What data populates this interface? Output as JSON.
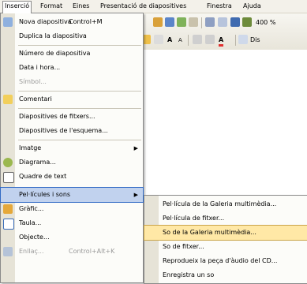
{
  "menubar": {
    "items": [
      {
        "label": "Inserció",
        "active": true
      },
      {
        "label": "Format"
      },
      {
        "label": "Eines"
      },
      {
        "label": "Presentació de diapositives"
      },
      {
        "label": "Finestra"
      },
      {
        "label": "Ajuda"
      }
    ]
  },
  "toolbar": {
    "zoom": "400 %",
    "font_grow_label": "A",
    "font_shrink_label": "A",
    "design_label": "Dis"
  },
  "insert_menu": {
    "items": [
      {
        "label": "Nova diapositiva",
        "shortcut": "Control+M",
        "icon": "new-slide-icon"
      },
      {
        "label": "Duplica la diapositiva"
      },
      {
        "label": "Número de diapositiva"
      },
      {
        "label": "Data i hora..."
      },
      {
        "label": "Símbol...",
        "disabled": true
      },
      {
        "label": "Comentari",
        "icon": "comment-icon"
      },
      {
        "label": "Diapositives de fitxers..."
      },
      {
        "label": "Diapositives de l'esquema..."
      },
      {
        "label": "Imatge",
        "submenu": true
      },
      {
        "label": "Diagrama...",
        "icon": "diagram-icon"
      },
      {
        "label": "Quadre de text",
        "icon": "text-box-icon"
      },
      {
        "label": "Pel·lícules i sons",
        "submenu": true,
        "highlighted": true,
        "icon": "movie-sound-icon"
      },
      {
        "label": "Gràfic...",
        "icon": "chart-icon"
      },
      {
        "label": "Taula...",
        "icon": "table-icon"
      },
      {
        "label": "Objecte..."
      },
      {
        "label": "Enllaç...",
        "shortcut": "Control+Alt+K",
        "disabled": true,
        "icon": "hyperlink-icon"
      }
    ]
  },
  "movies_submenu": {
    "items": [
      {
        "label": "Pel·lícula de la Galeria multimèdia...",
        "icon": "clip-movie-icon"
      },
      {
        "label": "Pel·lícula de fitxer..."
      },
      {
        "label": "So de la Galeria multimèdia...",
        "highlighted": true
      },
      {
        "label": "So de fitxer..."
      },
      {
        "label": "Reprodueix la peça d'àudio del CD...",
        "icon": "cd-audio-icon"
      },
      {
        "label": "Enregistra un so"
      }
    ]
  },
  "colors": {
    "menu_highlight": "#c1d2ee",
    "submenu_highlight": "#ffe8a6",
    "icon_gutter": "#e6e3d7"
  }
}
